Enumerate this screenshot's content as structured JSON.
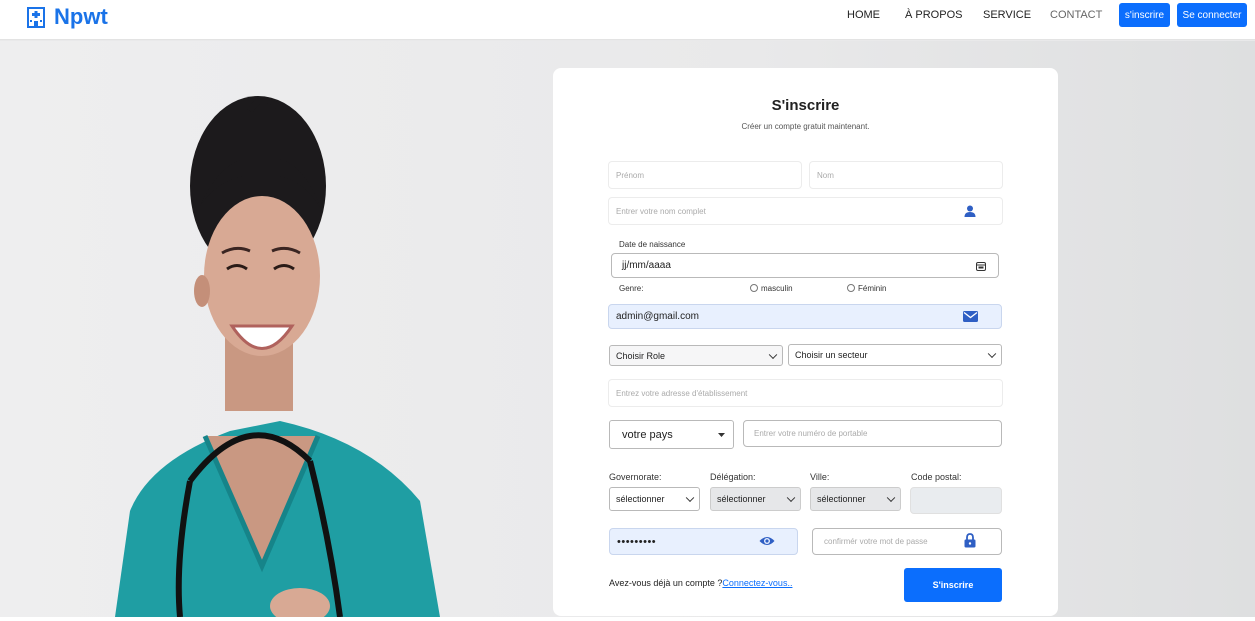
{
  "header": {
    "brand": "Npwt",
    "nav": [
      "HOME",
      "À PROPOS",
      "SERVICE",
      "CONTACT"
    ],
    "signup_button": "s'inscrire",
    "login_button": "Se connecter"
  },
  "form": {
    "title": "S'inscrire",
    "subtitle": "Créer un compte gratuit maintenant.",
    "prenom_placeholder": "Prénom",
    "nom_placeholder": "Nom",
    "fullname_placeholder": "Entrer votre nom complet",
    "birthdate_label": "Date de naissance",
    "birthdate_value": "jj/mm/aaaa",
    "gender_label": "Genre:",
    "gender_male": "masculin",
    "gender_female": "Féminin",
    "email_value": "admin@gmail.com",
    "role_select": "Choisir Role",
    "sector_select": "Choisir un secteur",
    "address_placeholder": "Entrez votre adresse d'établissement",
    "country_select": "votre pays",
    "phone_placeholder": "Entrer votre numéro de portable",
    "governorate_label": "Governorate:",
    "delegation_label": "Délégation:",
    "city_label": "Ville:",
    "postal_label": "Code postal:",
    "governorate_select": "sélectionner",
    "delegation_select": "sélectionner",
    "city_select": "sélectionner",
    "password_value": "•••••••••",
    "confirm_placeholder": "confirmér votre mot de passe",
    "have_account": "Avez-vous déjà un compte ?",
    "login_link": "Connectez-vous..",
    "submit_button": "S'inscrire"
  },
  "colors": {
    "accent": "#0b6efd",
    "brand": "#1a73e8",
    "scrubs": "#1f9ea3",
    "autofill": "#e8f0fe"
  }
}
